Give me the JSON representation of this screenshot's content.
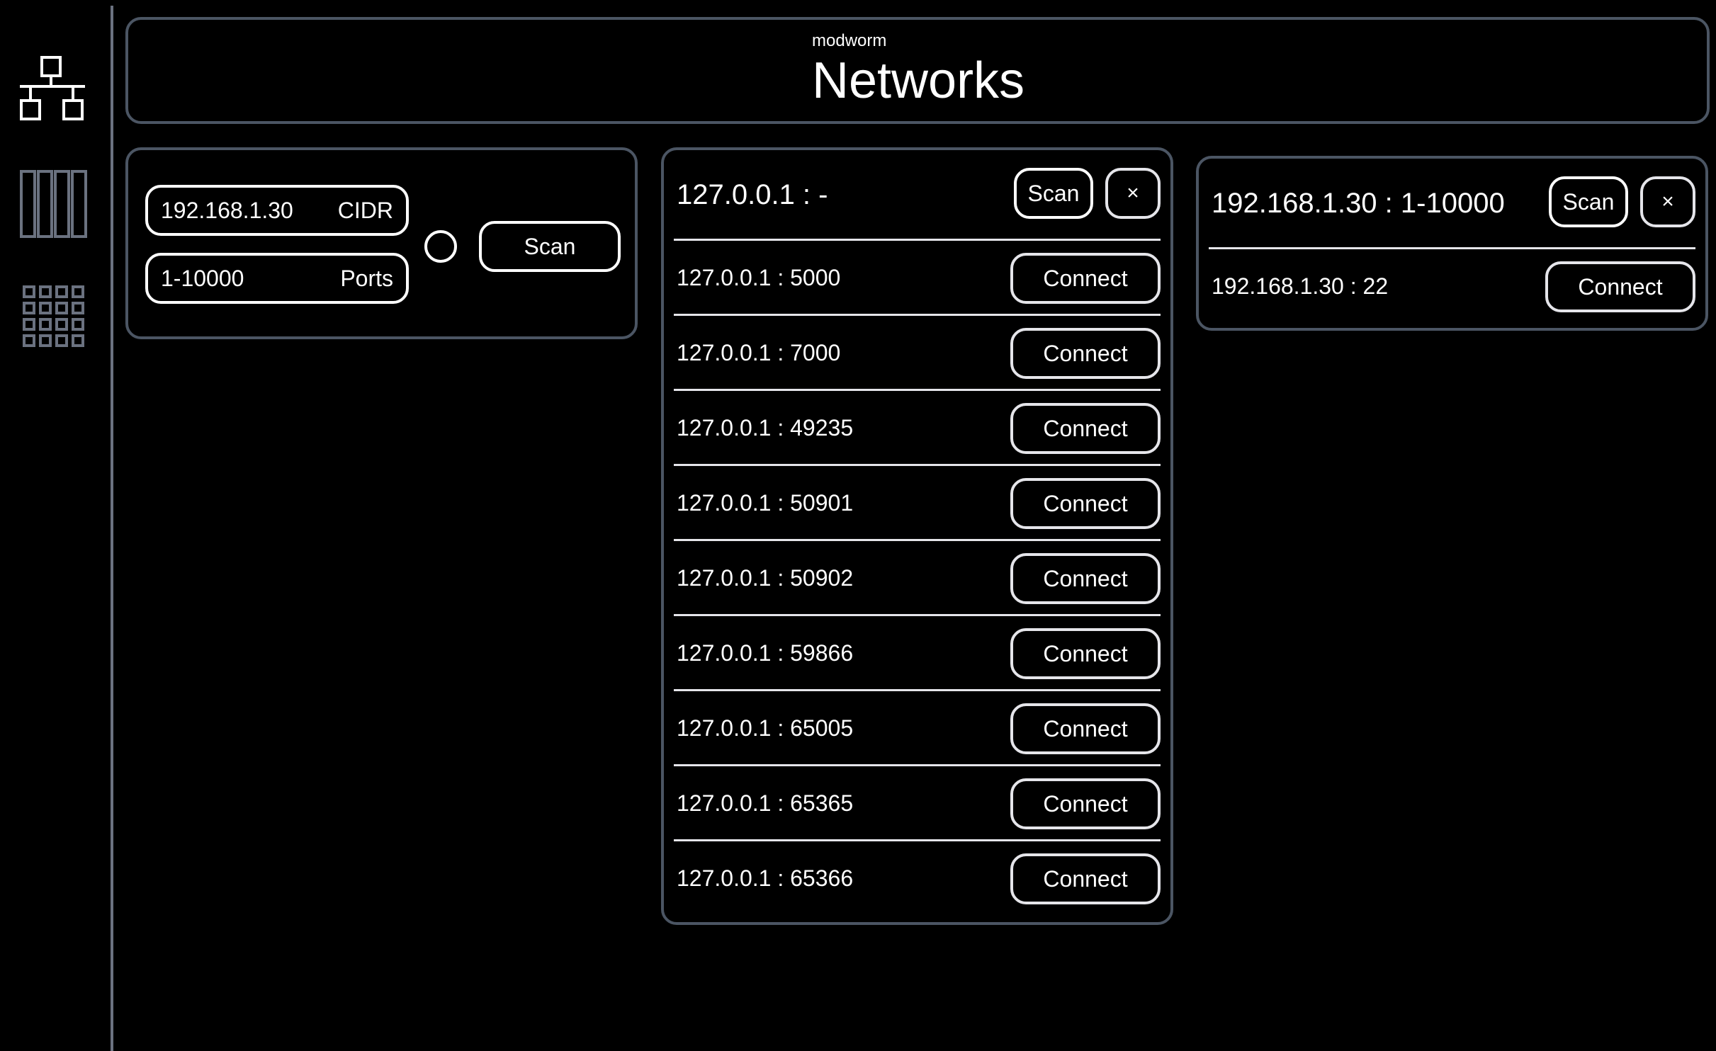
{
  "sidebar": {
    "items": [
      {
        "name": "network-icon",
        "label": "Networks",
        "active": true
      },
      {
        "name": "columns-icon",
        "label": "Columns",
        "active": false
      },
      {
        "name": "grid-icon",
        "label": "Grid",
        "active": false
      }
    ],
    "colors": {
      "active": "#ffffff",
      "inactive": "#6b7280",
      "divider": "#6b7280"
    }
  },
  "header": {
    "app_name": "modworm",
    "title": "Networks"
  },
  "scan_form": {
    "cidr": {
      "value": "192.168.1.30",
      "label": "CIDR"
    },
    "ports": {
      "value": "1-10000",
      "label": "Ports"
    },
    "scan_label": "Scan"
  },
  "results": [
    {
      "title": "127.0.0.1 : -",
      "scan_label": "Scan",
      "close_label": "×",
      "rows": [
        {
          "address": "127.0.0.1 : 5000",
          "action": "Connect"
        },
        {
          "address": "127.0.0.1 : 7000",
          "action": "Connect"
        },
        {
          "address": "127.0.0.1 : 49235",
          "action": "Connect"
        },
        {
          "address": "127.0.0.1 : 50901",
          "action": "Connect"
        },
        {
          "address": "127.0.0.1 : 50902",
          "action": "Connect"
        },
        {
          "address": "127.0.0.1 : 59866",
          "action": "Connect"
        },
        {
          "address": "127.0.0.1 : 65005",
          "action": "Connect"
        },
        {
          "address": "127.0.0.1 : 65365",
          "action": "Connect"
        },
        {
          "address": "127.0.0.1 : 65366",
          "action": "Connect"
        }
      ]
    },
    {
      "title": "192.168.1.30 : 1-10000",
      "scan_label": "Scan",
      "close_label": "×",
      "rows": [
        {
          "address": "192.168.1.30 : 22",
          "action": "Connect"
        }
      ]
    }
  ],
  "colors": {
    "background": "#000000",
    "panel_border": "#4b5563",
    "text": "#ffffff"
  }
}
